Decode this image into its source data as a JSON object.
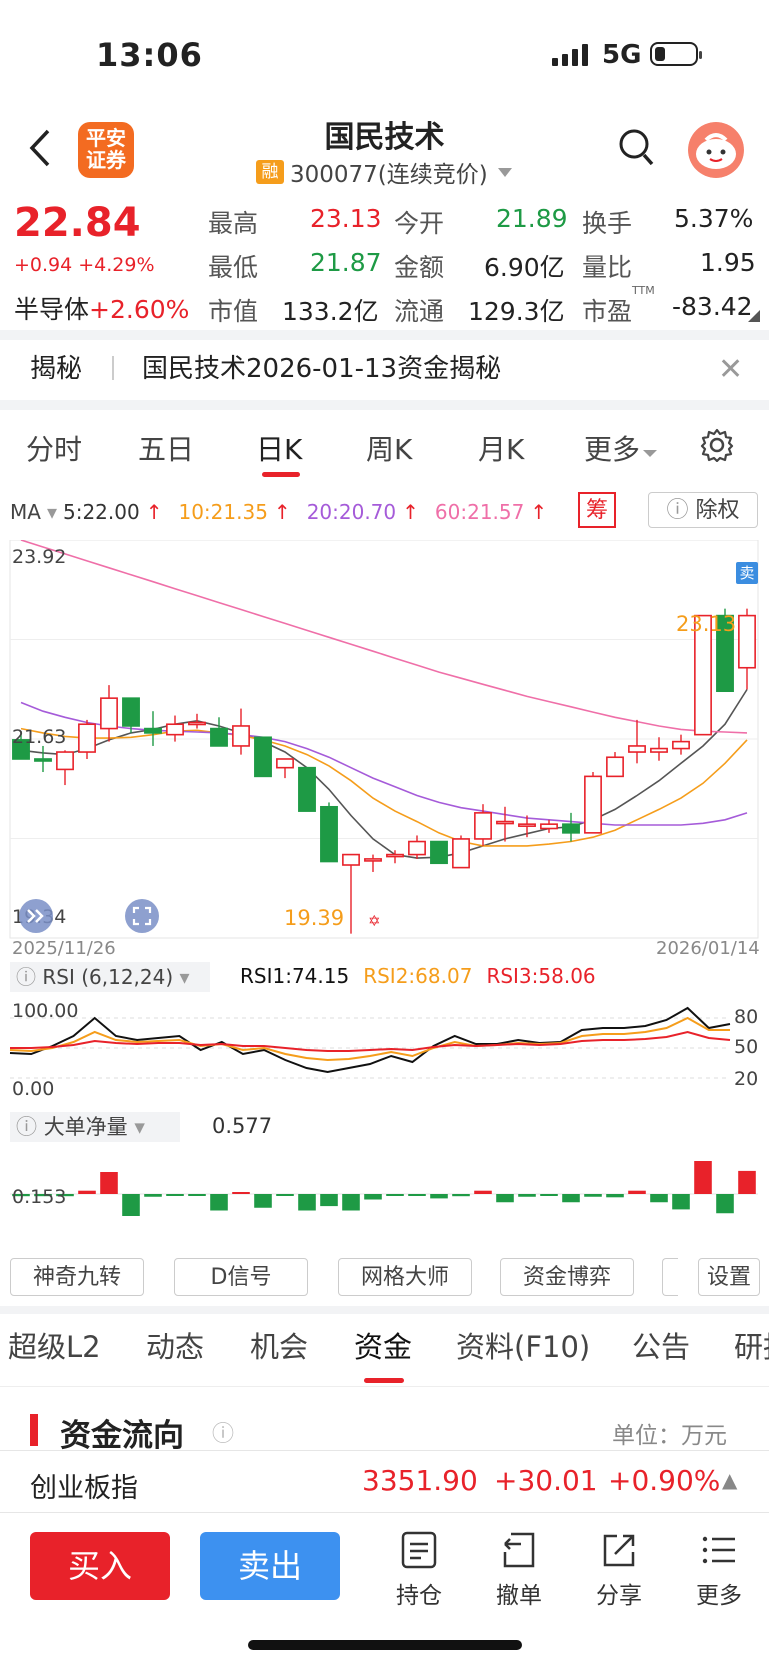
{
  "status_bar": {
    "time": "13:06",
    "network": "5G"
  },
  "header": {
    "logo_line1": "平安",
    "logo_line2": "证券",
    "stock_name": "国民技术",
    "rong_badge": "融",
    "code_line": "300077(连续竞价)"
  },
  "quote": {
    "price": "22.84",
    "change": "+0.94 +4.29%",
    "sector_name": "半导体",
    "sector_change": "+2.60%",
    "rows": [
      [
        {
          "label": "最高",
          "value": "23.13",
          "color": "red"
        },
        {
          "label": "今开",
          "value": "21.89",
          "color": "green"
        },
        {
          "label": "换手",
          "value": "5.37%",
          "color": "black"
        }
      ],
      [
        {
          "label": "最低",
          "value": "21.87",
          "color": "green"
        },
        {
          "label": "金额",
          "value": "6.90亿",
          "color": "black"
        },
        {
          "label": "量比",
          "value": "1.95",
          "color": "black"
        }
      ],
      [
        {
          "label": "市值",
          "value": "133.2亿",
          "color": "black"
        },
        {
          "label": "流通",
          "value": "129.3亿",
          "color": "black"
        },
        {
          "label": "市盈",
          "value": "-83.42",
          "color": "black"
        }
      ]
    ],
    "pe_superscript": "TTM"
  },
  "notice": {
    "tag": "揭秘",
    "text": "国民技术2026-01-13资金揭秘"
  },
  "chart_tabs": [
    "分时",
    "五日",
    "日K",
    "周K",
    "月K",
    "更多"
  ],
  "active_chart_tab": "日K",
  "ma": {
    "label": "MA",
    "items": [
      {
        "text": "5:22.00",
        "color": "#333333"
      },
      {
        "text": "10:21.35",
        "color": "#f59d1b"
      },
      {
        "text": "20:20.70",
        "color": "#a55bd9"
      },
      {
        "text": "60:21.57",
        "color": "#ef6fa8"
      }
    ]
  },
  "chou_label": "筹",
  "chuquan_label": "除权",
  "sell_flag": "卖",
  "chart_data": {
    "type": "candlestick",
    "y_axis_labels": [
      "23.92",
      "21.63",
      "19.34"
    ],
    "ylim": [
      19.34,
      23.92
    ],
    "x_labels": [
      "2025/11/26",
      "2026/01/14"
    ],
    "max_label": "23.13",
    "min_label": "19.39",
    "candles": [
      {
        "o": 21.62,
        "h": 21.72,
        "l": 21.4,
        "c": 21.4
      },
      {
        "o": 21.4,
        "h": 21.55,
        "l": 21.25,
        "c": 21.38
      },
      {
        "o": 21.28,
        "h": 21.5,
        "l": 21.1,
        "c": 21.48
      },
      {
        "o": 21.48,
        "h": 21.85,
        "l": 21.4,
        "c": 21.8
      },
      {
        "o": 21.75,
        "h": 22.25,
        "l": 21.6,
        "c": 22.1
      },
      {
        "o": 22.1,
        "h": 22.1,
        "l": 21.7,
        "c": 21.78
      },
      {
        "o": 21.75,
        "h": 21.95,
        "l": 21.55,
        "c": 21.7
      },
      {
        "o": 21.68,
        "h": 21.9,
        "l": 21.6,
        "c": 21.8
      },
      {
        "o": 21.82,
        "h": 21.92,
        "l": 21.75,
        "c": 21.82
      },
      {
        "o": 21.75,
        "h": 21.88,
        "l": 21.55,
        "c": 21.55
      },
      {
        "o": 21.55,
        "h": 21.98,
        "l": 21.45,
        "c": 21.78
      },
      {
        "o": 21.65,
        "h": 21.65,
        "l": 21.2,
        "c": 21.2
      },
      {
        "o": 21.3,
        "h": 21.4,
        "l": 21.18,
        "c": 21.4
      },
      {
        "o": 21.3,
        "h": 21.3,
        "l": 20.8,
        "c": 20.8
      },
      {
        "o": 20.85,
        "h": 20.9,
        "l": 20.22,
        "c": 20.22
      },
      {
        "o": 20.18,
        "h": 20.3,
        "l": 19.39,
        "c": 20.3
      },
      {
        "o": 20.25,
        "h": 20.3,
        "l": 20.1,
        "c": 20.25
      },
      {
        "o": 20.28,
        "h": 20.35,
        "l": 20.2,
        "c": 20.3
      },
      {
        "o": 20.3,
        "h": 20.52,
        "l": 20.25,
        "c": 20.45
      },
      {
        "o": 20.45,
        "h": 20.45,
        "l": 20.2,
        "c": 20.2
      },
      {
        "o": 20.15,
        "h": 20.52,
        "l": 20.15,
        "c": 20.48
      },
      {
        "o": 20.48,
        "h": 20.88,
        "l": 20.4,
        "c": 20.78
      },
      {
        "o": 20.68,
        "h": 20.85,
        "l": 20.45,
        "c": 20.68
      },
      {
        "o": 20.65,
        "h": 20.75,
        "l": 20.5,
        "c": 20.65
      },
      {
        "o": 20.6,
        "h": 20.7,
        "l": 20.55,
        "c": 20.65
      },
      {
        "o": 20.65,
        "h": 20.78,
        "l": 20.45,
        "c": 20.55
      },
      {
        "o": 20.55,
        "h": 21.25,
        "l": 20.55,
        "c": 21.2
      },
      {
        "o": 21.2,
        "h": 21.48,
        "l": 21.2,
        "c": 21.42
      },
      {
        "o": 21.48,
        "h": 21.85,
        "l": 21.35,
        "c": 21.55
      },
      {
        "o": 21.48,
        "h": 21.65,
        "l": 21.38,
        "c": 21.52
      },
      {
        "o": 21.52,
        "h": 21.68,
        "l": 21.45,
        "c": 21.6
      },
      {
        "o": 21.68,
        "h": 23.05,
        "l": 21.68,
        "c": 23.05
      },
      {
        "o": 23.05,
        "h": 23.13,
        "l": 22.18,
        "c": 22.18
      },
      {
        "o": 22.45,
        "h": 23.13,
        "l": 22.2,
        "c": 23.05
      }
    ],
    "ma_lines": [
      {
        "name": "MA5",
        "color": "#555555",
        "values": [
          21.5,
          21.47,
          21.45,
          21.52,
          21.62,
          21.7,
          21.74,
          21.8,
          21.84,
          21.78,
          21.7,
          21.6,
          21.48,
          21.3,
          21.05,
          20.75,
          20.48,
          20.3,
          20.26,
          20.27,
          20.32,
          20.4,
          20.48,
          20.54,
          20.6,
          20.62,
          20.7,
          20.82,
          20.98,
          21.15,
          21.35,
          21.55,
          21.8,
          22.2
        ]
      },
      {
        "name": "MA10",
        "color": "#f59d1b",
        "values": [
          21.75,
          21.7,
          21.66,
          21.64,
          21.64,
          21.65,
          21.68,
          21.72,
          21.73,
          21.7,
          21.67,
          21.62,
          21.55,
          21.45,
          21.32,
          21.15,
          20.95,
          20.8,
          20.68,
          20.55,
          20.45,
          20.4,
          20.4,
          20.4,
          20.42,
          20.45,
          20.5,
          20.58,
          20.7,
          20.82,
          20.95,
          21.12,
          21.35,
          21.62
        ]
      },
      {
        "name": "MA20",
        "color": "#a55bd9",
        "values": [
          22.05,
          21.95,
          21.88,
          21.82,
          21.78,
          21.75,
          21.73,
          21.72,
          21.71,
          21.7,
          21.68,
          21.65,
          21.6,
          21.52,
          21.42,
          21.3,
          21.18,
          21.08,
          20.98,
          20.9,
          20.84,
          20.8,
          20.76,
          20.72,
          20.7,
          20.68,
          20.66,
          20.64,
          20.64,
          20.64,
          20.64,
          20.66,
          20.7,
          20.78
        ]
      },
      {
        "name": "MA60",
        "color": "#ef6fa8",
        "values": [
          23.92,
          23.84,
          23.76,
          23.68,
          23.6,
          23.52,
          23.44,
          23.36,
          23.28,
          23.2,
          23.12,
          23.04,
          22.96,
          22.88,
          22.8,
          22.72,
          22.64,
          22.56,
          22.48,
          22.4,
          22.33,
          22.26,
          22.19,
          22.12,
          22.06,
          22.0,
          21.94,
          21.88,
          21.83,
          21.78,
          21.74,
          21.72,
          21.71,
          21.7
        ]
      }
    ]
  },
  "rsi": {
    "label": "RSI (6,12,24)",
    "rsi1": "RSI1:74.15",
    "rsi2": "RSI2:68.07",
    "rsi3": "RSI3:58.06",
    "left_labels": [
      "100.00",
      "0.00"
    ],
    "right_labels": [
      "80",
      "50",
      "20"
    ],
    "series": [
      {
        "name": "RSI1",
        "color": "#111111",
        "values": [
          45,
          44,
          52,
          62,
          80,
          62,
          58,
          60,
          62,
          48,
          56,
          44,
          48,
          38,
          30,
          26,
          30,
          34,
          42,
          36,
          52,
          62,
          54,
          54,
          58,
          55,
          56,
          68,
          70,
          70,
          72,
          78,
          90,
          70,
          74
        ]
      },
      {
        "name": "RSI2",
        "color": "#f59d1b",
        "values": [
          48,
          47,
          50,
          56,
          66,
          58,
          56,
          57,
          58,
          52,
          54,
          48,
          50,
          44,
          40,
          38,
          39,
          42,
          46,
          42,
          50,
          56,
          52,
          53,
          55,
          54,
          55,
          62,
          64,
          64,
          66,
          70,
          80,
          68,
          68
        ]
      },
      {
        "name": "RSI3",
        "color": "#e8222a",
        "values": [
          50,
          50,
          51,
          53,
          57,
          55,
          54,
          55,
          55,
          53,
          54,
          52,
          52,
          50,
          48,
          47,
          47,
          48,
          49,
          48,
          51,
          53,
          52,
          53,
          54,
          53,
          54,
          57,
          58,
          58,
          59,
          61,
          66,
          60,
          58
        ]
      }
    ]
  },
  "big_order": {
    "label": "大单净量",
    "value": "0.577",
    "axis_label": "0.153",
    "chart_data": {
      "type": "bar",
      "values": [
        -0.04,
        -0.04,
        -0.04,
        0.06,
        0.4,
        -0.4,
        -0.05,
        -0.03,
        -0.03,
        -0.3,
        0.02,
        -0.25,
        -0.03,
        -0.3,
        -0.22,
        -0.3,
        -0.1,
        -0.02,
        -0.02,
        -0.08,
        -0.04,
        0.06,
        -0.15,
        -0.05,
        -0.03,
        -0.15,
        -0.05,
        -0.06,
        0.06,
        -0.15,
        -0.28,
        0.6,
        -0.35,
        0.42
      ]
    }
  },
  "tools": [
    "神奇九转",
    "D信号",
    "网格大师",
    "资金博弈",
    "",
    "设置"
  ],
  "bottom_tabs": [
    "超级L2",
    "动态",
    "机会",
    "资金",
    "资料(F10)",
    "公告",
    "研报"
  ],
  "active_bottom_tab": "资金",
  "fund_flow": {
    "title": "资金流向",
    "unit": "单位：万元"
  },
  "index_row": {
    "name": "创业板指",
    "value": "3351.90",
    "change": "+30.01",
    "pct": "+0.90%"
  },
  "bottom_bar": {
    "buy": "买入",
    "sell": "卖出",
    "actions": [
      "持仓",
      "撤单",
      "分享",
      "更多"
    ]
  }
}
